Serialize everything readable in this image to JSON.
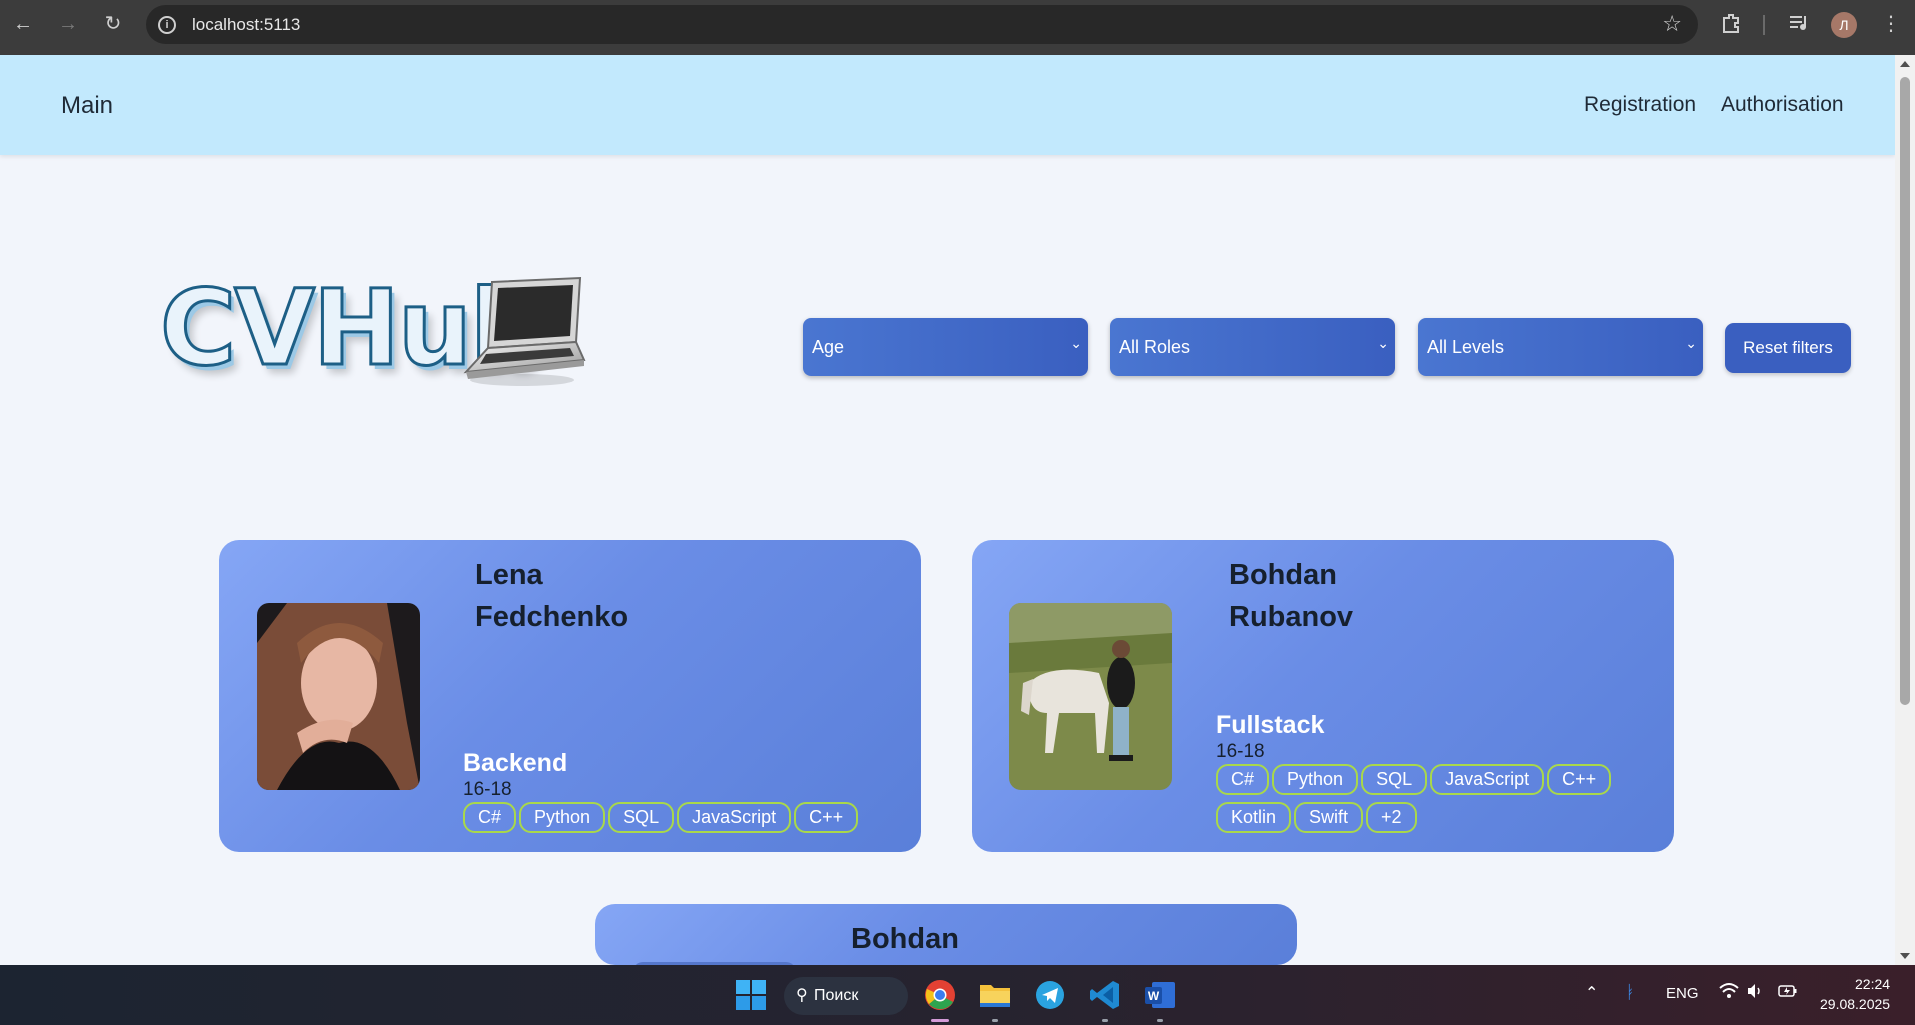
{
  "browser": {
    "url": "localhost:5113",
    "avatar_letter": "Л"
  },
  "header": {
    "brand": "Main",
    "nav": [
      "Registration",
      "Authorisation"
    ]
  },
  "logo": {
    "text": "CVHub",
    "icon": "laptop-icon"
  },
  "filters": {
    "age": "Age",
    "roles": "All Roles",
    "levels": "All Levels",
    "reset_label": "Reset filters"
  },
  "cards": [
    {
      "first_name": "Lena",
      "last_name": "Fedchenko",
      "role": "Backend",
      "age": "16-18",
      "tags": [
        "C#",
        "Python",
        "SQL",
        "JavaScript",
        "C++"
      ]
    },
    {
      "first_name": "Bohdan",
      "last_name": "Rubanov",
      "role": "Fullstack",
      "age": "16-18",
      "tags": [
        "C#",
        "Python",
        "SQL",
        "JavaScript",
        "C++",
        "Kotlin",
        "Swift",
        "+2"
      ]
    },
    {
      "first_name": "Bohdan"
    }
  ],
  "taskbar": {
    "search_label": "Поиск",
    "language": "ENG",
    "time": "22:24",
    "date": "29.08.2025"
  }
}
